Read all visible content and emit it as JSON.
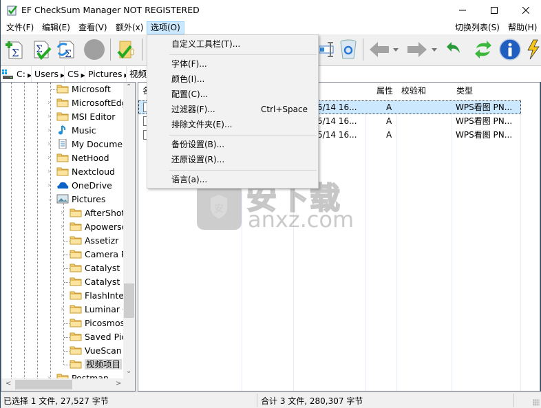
{
  "window": {
    "title": "EF CheckSum Manager NOT REGISTERED",
    "controls": {
      "minimize": "minimize",
      "maximize": "maximize",
      "close": "close"
    }
  },
  "menubar": {
    "items": [
      {
        "label": "文件(F)"
      },
      {
        "label": "编辑(E)"
      },
      {
        "label": "查看(V)"
      },
      {
        "label": "额外(x)"
      },
      {
        "label": "选项(O)",
        "active": true
      }
    ],
    "right_items": [
      {
        "label": "切换列表(S)"
      },
      {
        "label": "帮助(H)"
      }
    ]
  },
  "toolbar": {
    "buttons": [
      {
        "icon": "add-checksum-icon"
      },
      {
        "icon": "verify-checksum-icon"
      },
      {
        "icon": "update-checksum-icon"
      },
      {
        "icon": "stop-icon"
      },
      {
        "icon": "verify-folder-icon"
      },
      {
        "icon": "rename-icon"
      },
      {
        "icon": "recycle-bin-icon"
      },
      {
        "icon": "back-arrow-icon"
      },
      {
        "icon": "forward-arrow-icon"
      },
      {
        "icon": "up-undo-icon"
      },
      {
        "icon": "refresh-icon"
      },
      {
        "icon": "info-icon"
      },
      {
        "icon": "lightning-icon"
      }
    ]
  },
  "breadcrumb": {
    "items": [
      "C:",
      "Users",
      "CS",
      "Pictures",
      "视频"
    ]
  },
  "options_menu": {
    "items": [
      {
        "label": "自定义工具栏(T)..."
      },
      {
        "label": "字体(F)..."
      },
      {
        "label": "颜色(I)..."
      },
      {
        "label": "配置(C)..."
      },
      {
        "label": "过滤器(F)...",
        "shortcut": "Ctrl+Space"
      },
      {
        "label": "排除文件夹(E)..."
      },
      {
        "label": "备份设置(B)..."
      },
      {
        "label": "还原设置(R)..."
      },
      {
        "label": "语言(a)..."
      }
    ]
  },
  "tree": {
    "items": [
      {
        "label": "Microsoft",
        "level": 1,
        "icon": "folder-icon",
        "expandable": false
      },
      {
        "label": "MicrosoftEdge",
        "level": 1,
        "icon": "folder-icon",
        "expandable": true
      },
      {
        "label": "MSI Editor",
        "level": 1,
        "icon": "folder-icon",
        "expandable": true
      },
      {
        "label": "Music",
        "level": 1,
        "icon": "music-icon",
        "expandable": true
      },
      {
        "label": "My Documents",
        "level": 1,
        "icon": "document-icon",
        "expandable": true
      },
      {
        "label": "NetHood",
        "level": 1,
        "icon": "folder-icon",
        "expandable": true
      },
      {
        "label": "Nextcloud",
        "level": 1,
        "icon": "folder-icon",
        "expandable": true
      },
      {
        "label": "OneDrive",
        "level": 1,
        "icon": "cloud-icon",
        "expandable": true
      },
      {
        "label": "Pictures",
        "level": 1,
        "icon": "pictures-icon",
        "expandable": true,
        "expanded": true
      },
      {
        "label": "AfterShot",
        "level": 2,
        "icon": "folder-icon",
        "expandable": true
      },
      {
        "label": "Apowersoft",
        "level": 2,
        "icon": "folder-icon",
        "expandable": true
      },
      {
        "label": "Assetizr",
        "level": 2,
        "icon": "folder-icon",
        "expandable": false
      },
      {
        "label": "Camera Roll",
        "level": 2,
        "icon": "folder-icon",
        "expandable": false
      },
      {
        "label": "Catalyst Browse",
        "level": 2,
        "icon": "folder-icon",
        "expandable": false
      },
      {
        "label": "Catalyst Prepare",
        "level": 2,
        "icon": "folder-icon",
        "expandable": false
      },
      {
        "label": "FlashIntegro",
        "level": 2,
        "icon": "folder-icon",
        "expandable": true
      },
      {
        "label": "Luminar Collage",
        "level": 2,
        "icon": "folder-icon",
        "expandable": true
      },
      {
        "label": "Picosmos",
        "level": 2,
        "icon": "folder-icon",
        "expandable": false
      },
      {
        "label": "Saved Pictures",
        "level": 2,
        "icon": "folder-icon",
        "expandable": false
      },
      {
        "label": "VueScan",
        "level": 2,
        "icon": "folder-icon",
        "expandable": false
      },
      {
        "label": "视频项目",
        "level": 2,
        "icon": "folder-icon",
        "expandable": false,
        "selected": true
      },
      {
        "label": "Postman",
        "level": 1,
        "icon": "folder-icon",
        "expandable": true
      }
    ]
  },
  "filelist": {
    "columns": [
      "名称",
      "",
      "",
      "属性",
      "校验和",
      "类型"
    ],
    "rows": [
      {
        "date": "/5/14  16...",
        "attr": "A",
        "checksum": "",
        "type": "WPS看图 PN...",
        "selected": true
      },
      {
        "date": "/5/14  16...",
        "attr": "A",
        "checksum": "",
        "type": "WPS看图 PN...",
        "selected": false
      },
      {
        "date": "/5/14  16...",
        "attr": "A",
        "checksum": "",
        "type": "WPS看图 PN...",
        "selected": false
      }
    ]
  },
  "watermark": {
    "text_cn": "安下载",
    "text_en": "anxz.com",
    "badge": "安"
  },
  "statusbar": {
    "selected": "已选择 1 文件, 27,527 字节",
    "total": "合计 3 文件, 280,307 字节"
  },
  "colors": {
    "accent": "#0078d7",
    "selection": "#cce8ff",
    "menu_active_border": "#99d1ff"
  }
}
